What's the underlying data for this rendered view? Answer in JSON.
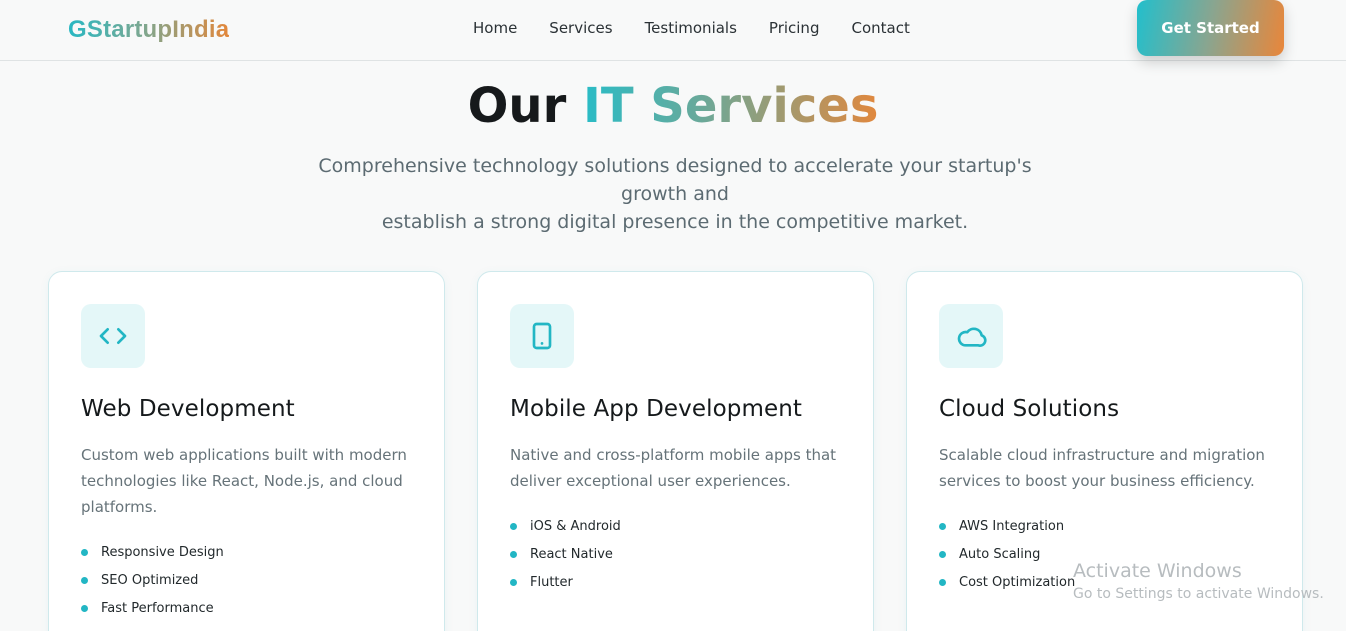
{
  "header": {
    "logo": "GStartupIndia",
    "nav": [
      "Home",
      "Services",
      "Testimonials",
      "Pricing",
      "Contact"
    ],
    "cta_label": "Get Started"
  },
  "section": {
    "title_part1": "Our",
    "title_part2": "IT Services",
    "subtitle_line1": "Comprehensive technology solutions designed to accelerate your startup's growth and",
    "subtitle_line2": "establish a strong digital presence in the competitive market."
  },
  "cards": [
    {
      "icon": "code-icon",
      "title": "Web Development",
      "desc": "Custom web applications built with modern technologies like React, Node.js, and cloud platforms.",
      "features": [
        "Responsive Design",
        "SEO Optimized",
        "Fast Performance"
      ]
    },
    {
      "icon": "tablet-icon",
      "title": "Mobile App Development",
      "desc": "Native and cross-platform mobile apps that deliver exceptional user experiences.",
      "features": [
        "iOS & Android",
        "React Native",
        "Flutter"
      ]
    },
    {
      "icon": "cloud-icon",
      "title": "Cloud Solutions",
      "desc": "Scalable cloud infrastructure and migration services to boost your business efficiency.",
      "features": [
        "AWS Integration",
        "Auto Scaling",
        "Cost Optimization"
      ]
    }
  ],
  "watermark": {
    "line1": "Activate Windows",
    "line2": "Go to Settings to activate Windows."
  },
  "colors": {
    "accent_teal": "#22b6c4",
    "accent_orange": "#e9863a",
    "icon_bg": "#e4f7f8"
  }
}
